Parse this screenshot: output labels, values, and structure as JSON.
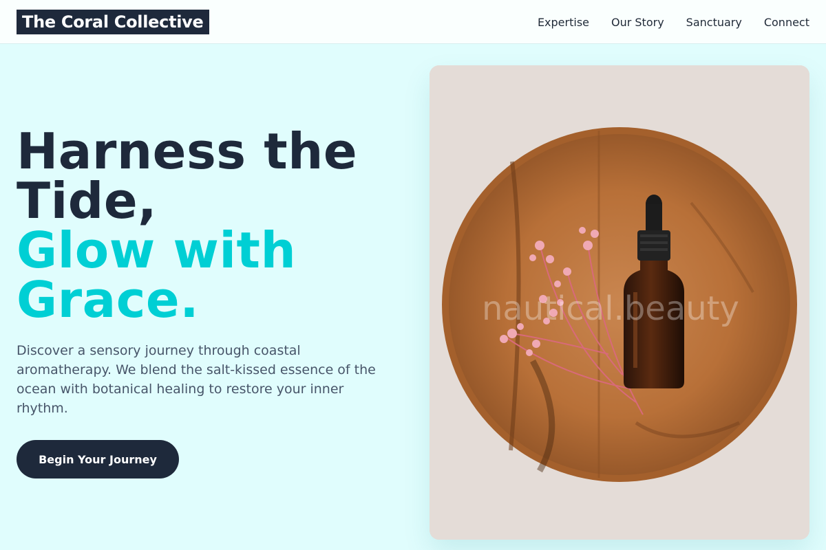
{
  "brand": {
    "name": "The Coral Collective"
  },
  "nav": {
    "items": [
      {
        "label": "Expertise"
      },
      {
        "label": "Our Story"
      },
      {
        "label": "Sanctuary"
      },
      {
        "label": "Connect"
      }
    ]
  },
  "hero": {
    "title_line1": "Harness the",
    "title_line2": "Tide,",
    "title_line3": "Glow with",
    "title_line4": "Grace.",
    "description": "Discover a sensory journey through coastal aromatherapy. We blend the salt-kissed essence of the ocean with botanical healing to restore your inner rhythm.",
    "cta_label": "Begin Your Journey"
  },
  "image": {
    "watermark": "nautical.beauty"
  },
  "colors": {
    "dark": "#1e293b",
    "accent": "#00cfd4",
    "background": "#e0fdfd"
  }
}
